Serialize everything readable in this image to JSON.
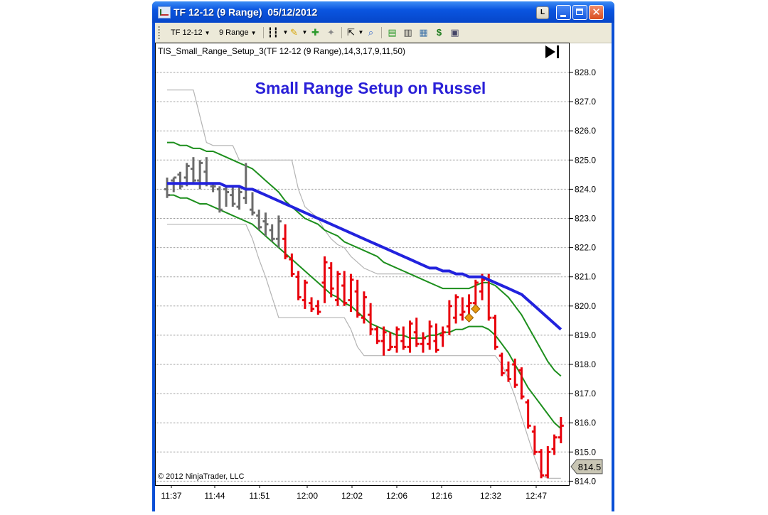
{
  "window": {
    "title": "TF 12-12 (9 Range)  05/12/2012",
    "buttons": {
      "layout": "L"
    }
  },
  "toolbar": {
    "instrument": "TF 12-12",
    "period": "9 Range"
  },
  "colors": {
    "bars_gray": "#6b6b6b",
    "bars_red": "#e8000b",
    "blue_ma": "#2222dd",
    "green_band": "#1d8f1d",
    "gray_line": "#b4b4b4",
    "signal_marker": "#e89a10",
    "title": "#2a20d8"
  },
  "chart_data": {
    "type": "line",
    "title": "Small Range Setup on Russel",
    "indicator_label": "TIS_Small_Range_Setup_3(TF 12-12 (9 Range),14,3,17,9,11,50)",
    "copyright": "© 2012 NinjaTrader, LLC",
    "price_marker": "814.5",
    "ylim": [
      813.5,
      828.3
    ],
    "y_ticks": [
      "828.0",
      "827.0",
      "826.0",
      "825.0",
      "824.0",
      "823.0",
      "822.0",
      "821.0",
      "820.0",
      "819.0",
      "818.0",
      "817.0",
      "816.0",
      "815.0",
      "814.0"
    ],
    "x_ticks": [
      "11:37",
      "11:44",
      "11:51",
      "12:00",
      "12:02",
      "12:06",
      "12:16",
      "12:32",
      "12:47"
    ],
    "grid": true,
    "bars": {
      "count": 61,
      "ohlc": [
        [
          824.0,
          824.4,
          823.7,
          823.8
        ],
        [
          824.3,
          824.4,
          823.9,
          824.4
        ],
        [
          824.5,
          824.6,
          824.0,
          824.1
        ],
        [
          824.4,
          824.9,
          824.1,
          824.8
        ],
        [
          824.7,
          825.1,
          824.2,
          824.3
        ],
        [
          824.3,
          825.0,
          824.0,
          824.9
        ],
        [
          824.6,
          825.1,
          824.1,
          824.2
        ],
        [
          824.1,
          824.2,
          823.9,
          824.1
        ],
        [
          824.0,
          824.1,
          823.2,
          823.3
        ],
        [
          824.0,
          824.1,
          823.4,
          823.9
        ],
        [
          823.8,
          824.1,
          823.4,
          823.5
        ],
        [
          823.4,
          824.1,
          823.3,
          823.9
        ],
        [
          823.7,
          824.9,
          823.5,
          824.0
        ],
        [
          823.3,
          823.9,
          823.1,
          823.2
        ],
        [
          823.1,
          823.3,
          822.6,
          822.7
        ],
        [
          822.9,
          823.2,
          822.4,
          822.8
        ],
        [
          822.6,
          822.8,
          822.2,
          822.3
        ],
        [
          822.3,
          823.1,
          822.0,
          822.9
        ],
        [
          822.3,
          822.8,
          821.6,
          821.7
        ],
        [
          821.6,
          821.8,
          821.0,
          821.1
        ],
        [
          821.0,
          821.2,
          820.2,
          820.3
        ],
        [
          820.2,
          820.9,
          819.9,
          820.8
        ],
        [
          820.1,
          820.3,
          819.8,
          819.9
        ],
        [
          820.0,
          820.2,
          819.7,
          819.8
        ],
        [
          820.8,
          821.7,
          820.1,
          821.5
        ],
        [
          821.3,
          821.5,
          820.3,
          820.6
        ],
        [
          820.2,
          821.2,
          820.0,
          821.1
        ],
        [
          820.7,
          821.2,
          820.0,
          820.1
        ],
        [
          820.2,
          821.1,
          819.8,
          820.9
        ],
        [
          820.5,
          820.9,
          819.6,
          819.7
        ],
        [
          819.6,
          820.5,
          819.4,
          820.3
        ],
        [
          819.7,
          820.1,
          819.0,
          819.2
        ],
        [
          819.2,
          819.3,
          818.7,
          818.8
        ],
        [
          818.8,
          819.3,
          818.3,
          819.1
        ],
        [
          818.5,
          819.1,
          818.5,
          818.6
        ],
        [
          818.6,
          819.3,
          818.4,
          819.2
        ],
        [
          818.8,
          819.3,
          818.5,
          818.6
        ],
        [
          818.6,
          819.5,
          818.4,
          819.4
        ],
        [
          819.1,
          819.6,
          818.6,
          818.7
        ],
        [
          818.7,
          819.1,
          818.4,
          818.9
        ],
        [
          818.7,
          819.5,
          818.5,
          819.3
        ],
        [
          818.8,
          819.4,
          818.4,
          818.5
        ],
        [
          819.0,
          819.3,
          818.6,
          819.1
        ],
        [
          819.3,
          820.2,
          819.0,
          820.0
        ],
        [
          819.6,
          820.4,
          819.4,
          820.3
        ],
        [
          819.7,
          820.3,
          819.5,
          819.8
        ],
        [
          820.0,
          820.4,
          819.7,
          820.1
        ],
        [
          820.1,
          820.9,
          819.8,
          820.8
        ],
        [
          820.5,
          821.1,
          820.2,
          820.9
        ],
        [
          820.9,
          821.1,
          819.5,
          819.6
        ],
        [
          819.6,
          819.7,
          818.5,
          818.6
        ],
        [
          818.3,
          818.4,
          817.6,
          817.7
        ],
        [
          817.8,
          818.1,
          817.4,
          817.5
        ],
        [
          818.0,
          818.2,
          817.2,
          817.3
        ],
        [
          817.8,
          817.9,
          816.8,
          816.9
        ],
        [
          816.7,
          816.8,
          815.8,
          815.9
        ],
        [
          815.7,
          815.9,
          814.9,
          815.0
        ],
        [
          815.0,
          815.1,
          814.1,
          814.2
        ],
        [
          814.2,
          815.2,
          814.1,
          815.0
        ],
        [
          815.1,
          815.6,
          814.9,
          815.5
        ],
        [
          815.5,
          816.2,
          815.3,
          815.9
        ]
      ]
    },
    "series": [
      {
        "name": "Blue Moving Average",
        "values": [
          824.2,
          824.2,
          824.2,
          824.2,
          824.2,
          824.2,
          824.2,
          824.2,
          824.2,
          824.1,
          824.1,
          824.1,
          824.0,
          824.0,
          823.9,
          823.8,
          823.7,
          823.6,
          823.5,
          823.4,
          823.3,
          823.2,
          823.1,
          823.0,
          822.9,
          822.8,
          822.7,
          822.6,
          822.5,
          822.4,
          822.3,
          822.2,
          822.1,
          822.0,
          821.9,
          821.8,
          821.7,
          821.6,
          821.5,
          821.4,
          821.3,
          821.3,
          821.2,
          821.2,
          821.1,
          821.1,
          821.0,
          821.0,
          821.0,
          820.9,
          820.8,
          820.7,
          820.6,
          820.5,
          820.4,
          820.2,
          820.0,
          819.8,
          819.6,
          819.4,
          819.2
        ]
      },
      {
        "name": "Upper Band",
        "values": [
          825.6,
          825.6,
          825.5,
          825.5,
          825.4,
          825.4,
          825.3,
          825.3,
          825.2,
          825.1,
          825.0,
          824.9,
          824.8,
          824.7,
          824.5,
          824.3,
          824.1,
          823.9,
          823.6,
          823.4,
          823.2,
          823.0,
          822.9,
          822.8,
          822.6,
          822.5,
          822.4,
          822.2,
          822.1,
          822.0,
          821.9,
          821.8,
          821.7,
          821.5,
          821.4,
          821.3,
          821.2,
          821.1,
          821.0,
          820.9,
          820.8,
          820.7,
          820.6,
          820.6,
          820.6,
          820.6,
          820.6,
          820.7,
          820.8,
          820.8,
          820.7,
          820.5,
          820.3,
          820.0,
          819.7,
          819.3,
          818.9,
          818.5,
          818.1,
          817.8,
          817.6
        ]
      },
      {
        "name": "Lower Band",
        "values": [
          823.8,
          823.8,
          823.7,
          823.7,
          823.6,
          823.5,
          823.5,
          823.4,
          823.3,
          823.2,
          823.1,
          823.0,
          822.9,
          822.8,
          822.6,
          822.4,
          822.2,
          822.0,
          821.8,
          821.6,
          821.4,
          821.2,
          821.0,
          820.8,
          820.6,
          820.4,
          820.3,
          820.1,
          820.0,
          819.8,
          819.6,
          819.4,
          819.3,
          819.2,
          819.1,
          819.0,
          819.0,
          818.9,
          818.9,
          818.9,
          819.0,
          819.0,
          819.1,
          819.1,
          819.2,
          819.2,
          819.3,
          819.3,
          819.3,
          819.2,
          819.0,
          818.7,
          818.4,
          818.0,
          817.6,
          817.2,
          816.9,
          816.6,
          816.3,
          816.0,
          815.8
        ]
      },
      {
        "name": "Trailing Stop",
        "values": [
          827.4,
          827.4,
          827.4,
          827.4,
          827.4,
          826.5,
          825.6,
          825.5,
          825.5,
          825.5,
          825.5,
          825.0,
          825.0,
          825.0,
          825.0,
          825.0,
          825.0,
          825.0,
          825.0,
          825.0,
          824.0,
          823.4,
          823.2,
          823.0,
          822.6,
          822.3,
          822.1,
          822.0,
          821.7,
          821.5,
          821.3,
          821.2,
          821.1,
          821.1,
          821.1,
          821.1,
          821.1,
          821.1,
          821.1,
          821.1,
          821.1,
          821.1,
          821.1,
          821.1,
          821.1,
          821.1,
          821.1,
          821.1,
          821.1,
          821.1,
          821.1,
          821.1,
          821.1,
          821.1,
          821.1,
          821.1,
          821.1,
          821.1,
          821.1,
          821.1,
          821.1
        ]
      },
      {
        "name": "Lower Stop",
        "values": [
          822.8,
          822.8,
          822.8,
          822.8,
          822.8,
          822.8,
          822.8,
          822.8,
          822.8,
          822.8,
          822.8,
          822.8,
          822.8,
          822.3,
          821.6,
          821.0,
          820.3,
          819.6,
          819.6,
          819.6,
          819.6,
          819.6,
          819.6,
          819.6,
          819.6,
          819.6,
          819.6,
          819.6,
          819.2,
          818.6,
          818.3,
          818.3,
          818.3,
          818.3,
          818.3,
          818.3,
          818.3,
          818.3,
          818.3,
          818.3,
          818.3,
          818.3,
          818.3,
          818.3,
          818.3,
          818.3,
          818.3,
          818.3,
          818.3,
          818.3,
          818.3,
          818.0,
          817.5,
          816.9,
          816.2,
          815.5,
          814.8,
          814.2,
          814.1,
          814.1,
          814.1
        ]
      }
    ],
    "signal_markers": [
      {
        "bar": 46,
        "price": 819.6
      },
      {
        "bar": 47,
        "price": 819.9
      }
    ]
  }
}
